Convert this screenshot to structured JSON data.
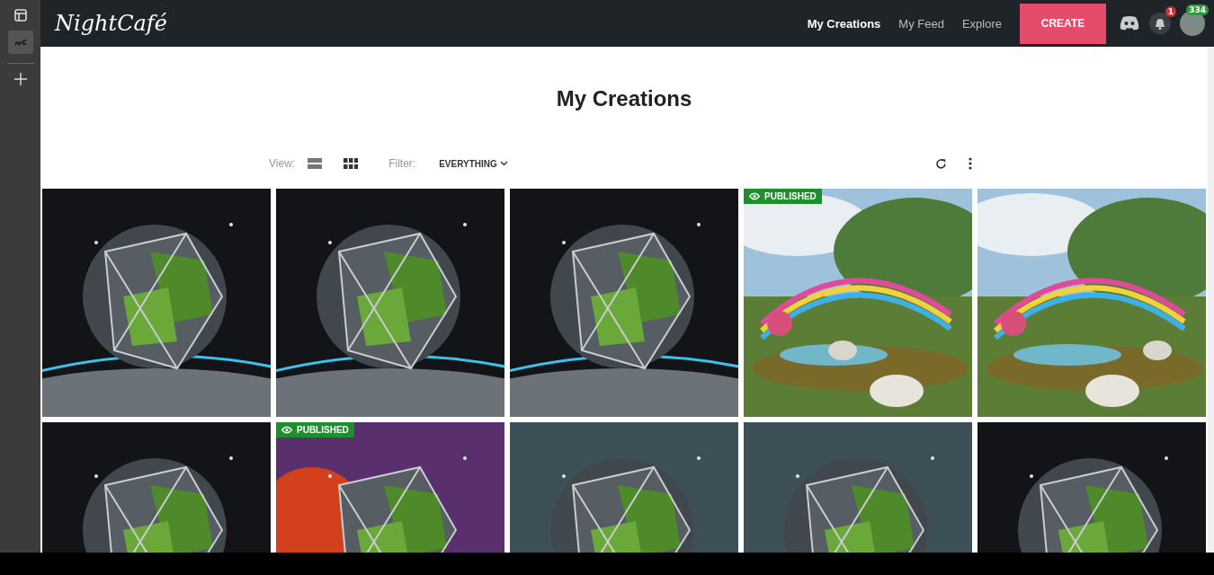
{
  "nav": {
    "logo": "NightCafé",
    "links": [
      {
        "label": "My Creations",
        "selected": true
      },
      {
        "label": "My Feed",
        "selected": false
      },
      {
        "label": "Explore",
        "selected": false
      }
    ],
    "create_button": "CREATE",
    "notification_count": "1",
    "avatar_badge": "334"
  },
  "page": {
    "title": "My Creations",
    "view_label": "View:",
    "views": [
      {
        "kind": "list",
        "selected": false
      },
      {
        "kind": "grid",
        "selected": true
      }
    ],
    "filter_label": "Filter:",
    "filter_value": "EVERYTHING"
  },
  "creations": [
    {
      "kind": "picture",
      "published": false
    },
    {
      "kind": "picture",
      "published": false
    },
    {
      "kind": "picture",
      "published": false
    },
    {
      "kind": "picture",
      "published": true,
      "badge": "PUBLISHED"
    },
    {
      "kind": "picture",
      "published": false
    },
    {
      "kind": "picture",
      "published": false
    },
    {
      "kind": "picture",
      "published": true,
      "badge": "PUBLISHED"
    },
    {
      "kind": "picture",
      "published": false
    },
    {
      "kind": "picture",
      "published": false
    },
    {
      "kind": "picture",
      "published": false
    }
  ]
}
